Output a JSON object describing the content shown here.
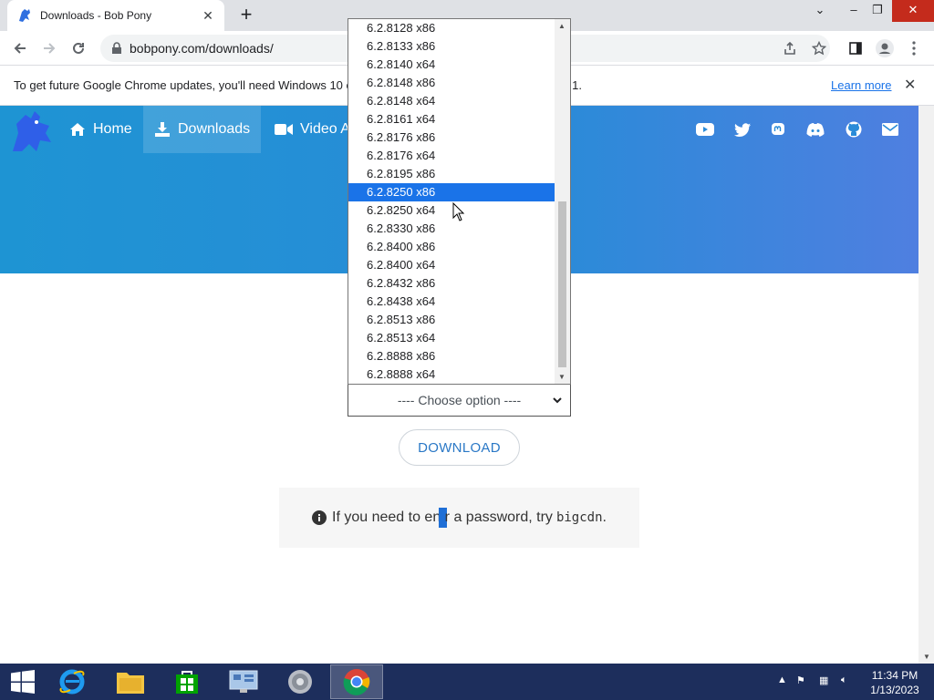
{
  "browser": {
    "tab_title": "Downloads - Bob Pony",
    "new_tab": "+",
    "url": "bobpony.com/downloads/",
    "infobar_message": "To get future Google Chrome updates, you'll need Windows 10 or later. This computer is using Windows 8.1.",
    "infobar_link": "Learn more"
  },
  "site": {
    "nav": {
      "home": "Home",
      "downloads": "Downloads",
      "video": "Video A"
    }
  },
  "dropdown": {
    "options": [
      "6.2.8128 x86",
      "6.2.8133 x86",
      "6.2.8140 x64",
      "6.2.8148 x86",
      "6.2.8148 x64",
      "6.2.8161 x64",
      "6.2.8176 x86",
      "6.2.8176 x64",
      "6.2.8195 x86",
      "6.2.8250 x86",
      "6.2.8250 x64",
      "6.2.8330 x86",
      "6.2.8400 x86",
      "6.2.8400 x64",
      "6.2.8432 x86",
      "6.2.8438 x64",
      "6.2.8513 x86",
      "6.2.8513 x64",
      "6.2.8888 x86",
      "6.2.8888 x64"
    ],
    "highlighted": "6.2.8250 x86"
  },
  "form": {
    "select_value": "---- Choose option ----",
    "download_label": "DOWNLOAD",
    "notice_before": "If you need to ent",
    "notice_after": "r a password, try",
    "notice_code": "bigcdn",
    "notice_end": "."
  },
  "taskbar": {
    "time": "11:34 PM",
    "date": "1/13/2023"
  },
  "colors": {
    "accent": "#1a73e8",
    "hero_blue": "#2a8bd8",
    "taskbar": "#1d2e5c",
    "close_red": "#c42b1c"
  }
}
